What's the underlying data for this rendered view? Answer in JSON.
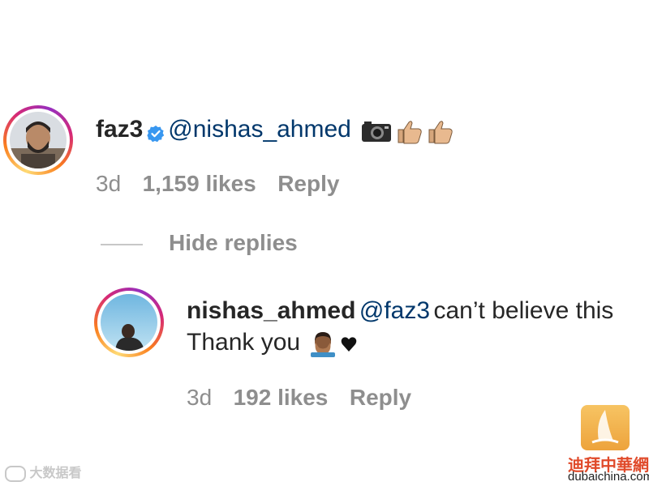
{
  "comment": {
    "username": "faz3",
    "mention": "@nishas_ahmed",
    "emojis": [
      "camera-emoji",
      "thumbs-up-emoji",
      "thumbs-up-emoji"
    ],
    "time": "3d",
    "likes": "1,159 likes",
    "reply": "Reply"
  },
  "hide_replies": "Hide replies",
  "reply_comment": {
    "username": "nishas_ahmed",
    "mention": "@faz3",
    "text_line1": "can’t believe this",
    "text_line2": "Thank you",
    "emojis": [
      "facepalm-emoji",
      "black-heart-emoji"
    ],
    "time": "3d",
    "likes": "192 likes",
    "reply": "Reply"
  },
  "watermark": {
    "left_text": "大数据看",
    "site_cn": "迪拜中華網",
    "site_url": "dubaichina.com"
  },
  "colors": {
    "mention": "#00376b",
    "meta": "#8e8e8e",
    "verified": "#3897f0"
  }
}
